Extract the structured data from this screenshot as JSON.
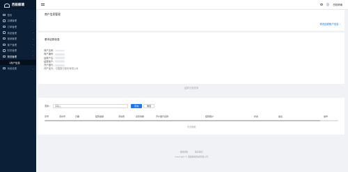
{
  "app": {
    "title": "西极鲸塘"
  },
  "topbar": {
    "user_label": "西极鲸塘"
  },
  "sidebar": {
    "items": [
      {
        "label": "首页",
        "has_children": false
      },
      {
        "label": "店铺管理",
        "has_children": true
      },
      {
        "label": "订单管理",
        "has_children": false
      },
      {
        "label": "商品管理",
        "has_children": true
      },
      {
        "label": "营销管理",
        "has_children": true
      },
      {
        "label": "客户管理",
        "has_children": true
      },
      {
        "label": "财务管理",
        "has_children": true
      },
      {
        "label": "物流管理",
        "has_children": true
      }
    ],
    "sub_items": [
      {
        "label": "1商户信息"
      }
    ],
    "after_items": [
      {
        "label": "系统设置",
        "has_children": true
      }
    ]
  },
  "page": {
    "title": "商户信息管理",
    "head_link": "修改结算账户信息 ›"
  },
  "info": {
    "card_title": "基本结算信息",
    "fields": [
      {
        "label": "商户名称：",
        "value": "",
        "masked": true
      },
      {
        "label": "商户编号：",
        "value": "",
        "masked": true
      },
      {
        "label": "结算户名：",
        "value": "",
        "masked": true
      },
      {
        "label": "结算账户：",
        "value": "",
        "masked": true
      },
      {
        "label": "开户银行：",
        "value": "",
        "masked": true
      },
      {
        "label": "开户支行：",
        "value": "中国银行股份有限公司",
        "masked": false
      }
    ]
  },
  "divider": {
    "label": "结算记录查询"
  },
  "search": {
    "label": "流水：",
    "placeholder": "请输入",
    "query_button": "查询",
    "reset_button": "重置"
  },
  "table": {
    "columns": [
      "序号",
      "流水号",
      "日期",
      "结算金额",
      "手续费",
      "实际到账",
      "开户银行名称",
      "结算账户",
      "状态",
      "备注",
      "操作"
    ],
    "empty_text": "暂无数据"
  },
  "footer": {
    "links": [
      "使用帮助",
      "联系我们"
    ],
    "copyright": "Copyright © 西极鲸塘科技有限公司"
  },
  "colors": {
    "sidebar_bg": "#0b1f36",
    "accent": "#1677ff"
  }
}
